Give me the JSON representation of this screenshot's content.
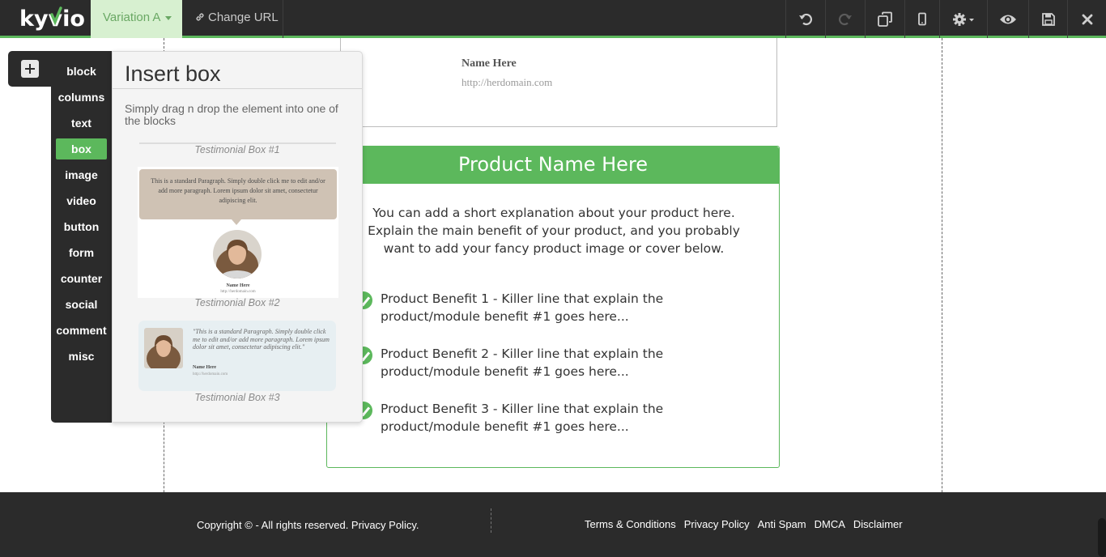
{
  "toolbar": {
    "logo_text": "kyvio",
    "variation_label": "Variation A",
    "change_url_label": "Change URL",
    "tools": [
      "undo-icon",
      "redo-icon",
      "copy-icon",
      "mobile-icon",
      "settings-icon",
      "eye-icon",
      "save-icon",
      "close-icon"
    ],
    "colors": {
      "bar": "#2b2b2b",
      "accent": "#5cb85c",
      "variation_bg": "#d7f0d0"
    }
  },
  "sidebar": {
    "categories": [
      "block",
      "columns",
      "text",
      "box",
      "image",
      "video",
      "button",
      "form",
      "counter",
      "social",
      "comment",
      "misc"
    ],
    "active_category": "box"
  },
  "insert_panel": {
    "title": "Insert box",
    "description": "Simply drag n drop the element into one of the blocks",
    "items": [
      {
        "caption": "Testimonial Box #1"
      },
      {
        "caption": "Testimonial Box #2",
        "paragraph": "This is a standard Paragraph. Simply double click me to edit and/or add more paragraph. Lorem ipsum dolor sit amet, consectetur adipiscing elit.",
        "name": "Name Here",
        "url": "http://herdomain.com"
      },
      {
        "caption": "Testimonial Box #3",
        "quote": "\"This is a standard Paragraph. Simply double click me to edit and/or add more paragraph. Lorem ipsum dolor sit amet, consectetur adipiscing elit.\"",
        "name": "Name Here",
        "url": "http://herdomain.com"
      }
    ]
  },
  "page": {
    "testimonial": {
      "name": "Name Here",
      "url": "http://herdomain.com"
    },
    "product": {
      "title": "Product Name Here",
      "description": "You can add  a short explanation about your product here. Explain the main benefit of your product, and you probably want to add your fancy product image or cover below.",
      "benefits": [
        "Product Benefit 1 - Killer line that explain the product/module benefit #1 goes here...",
        "Product Benefit 2 - Killer line that explain the product/module benefit #1 goes here...",
        "Product Benefit 3 - Killer line that explain the product/module benefit #1 goes here..."
      ]
    }
  },
  "footer": {
    "copyright": "Copyright © - All rights reserved. Privacy Policy.",
    "links": [
      "Terms & Conditions",
      "Privacy Policy",
      "Anti Spam",
      "DMCA",
      "Disclaimer"
    ]
  }
}
